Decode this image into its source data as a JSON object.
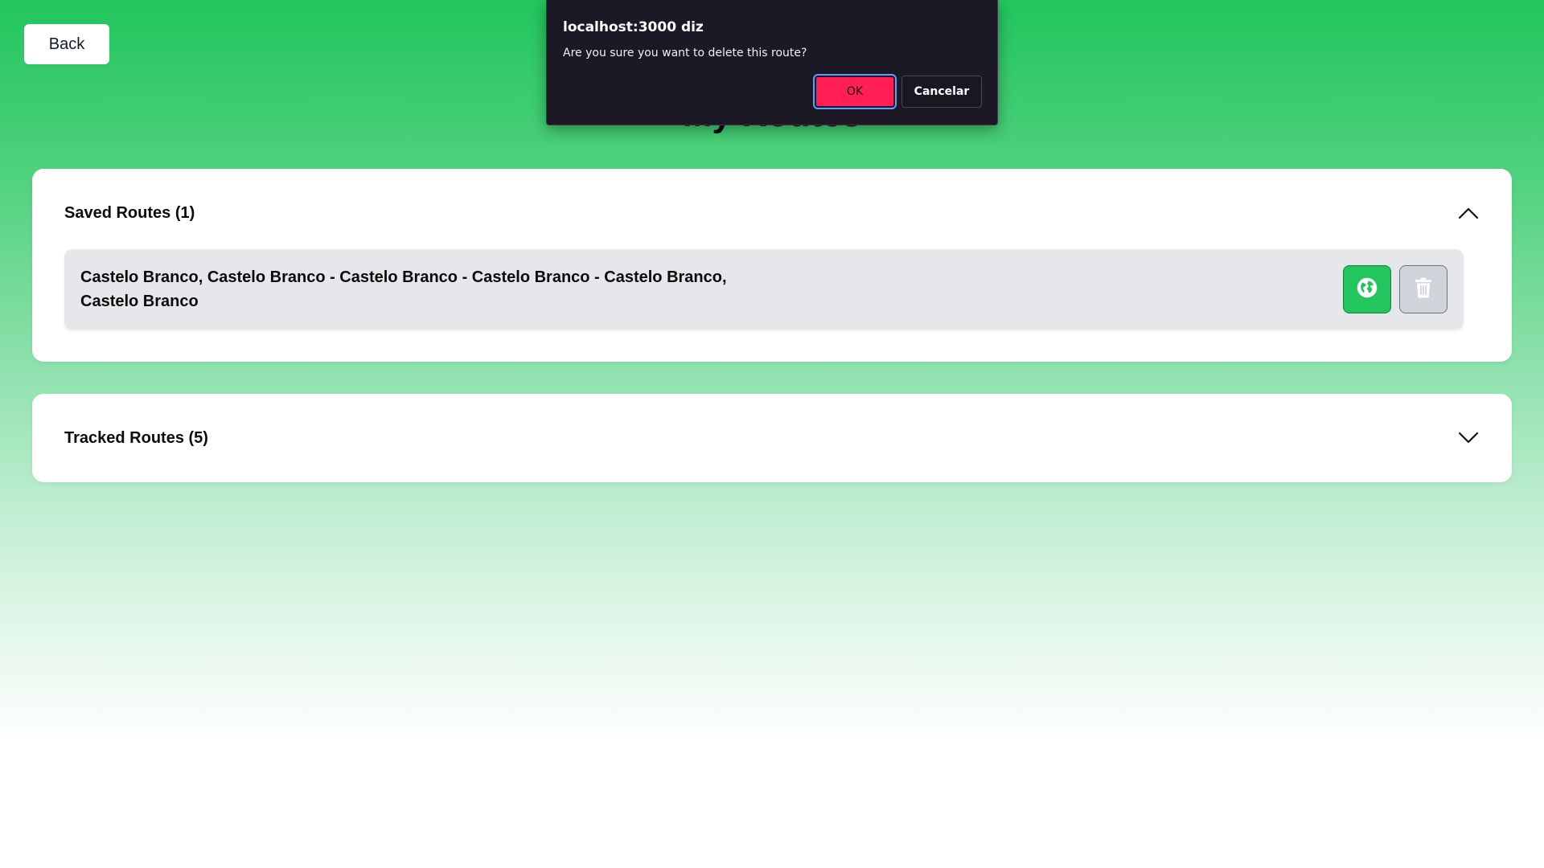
{
  "nav": {
    "back_label": "Back"
  },
  "page": {
    "title": "My Routes"
  },
  "saved_routes": {
    "title": "Saved Routes (1)",
    "expanded": true,
    "items": [
      {
        "line1": "Castelo Branco, Castelo Branco - Castelo Branco - Castelo Branco - Castelo Branco,",
        "line2": "Castelo Branco",
        "view_icon": "globe-icon",
        "delete_icon": "trash-icon"
      }
    ]
  },
  "tracked_routes": {
    "title": "Tracked Routes (5)",
    "expanded": false
  },
  "dialog": {
    "title": "localhost:3000 diz",
    "message": "Are you sure you want to delete this route?",
    "ok_label": "OK",
    "cancel_label": "Cancelar"
  },
  "colors": {
    "accent_green": "#22c55e",
    "ok_button": "#ff1f55",
    "dialog_bg": "#1c1826"
  }
}
